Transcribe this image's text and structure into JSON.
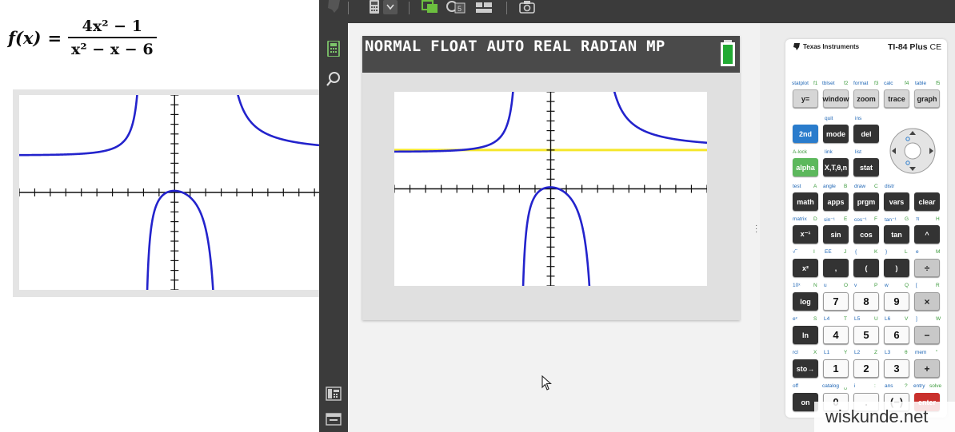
{
  "formula": {
    "lhs": "f(x)",
    "equals": "=",
    "numerator": "4x² − 1",
    "denominator": "x² − x − 6"
  },
  "calculator": {
    "status_text": "NORMAL FLOAT AUTO REAL RADIAN MP",
    "brand": "Texas Instruments",
    "model": "TI-84 Plus",
    "model_suffix": "CE"
  },
  "keys": {
    "y_equals": "y=",
    "window": "window",
    "zoom": "zoom",
    "trace": "trace",
    "graph": "graph",
    "second": "2nd",
    "mode": "mode",
    "del": "del",
    "alpha": "alpha",
    "xt_theta_n": "X,T,θ,n",
    "stat": "stat",
    "math": "math",
    "apps": "apps",
    "prgm": "prgm",
    "vars": "vars",
    "clear": "clear",
    "x_inverse": "x⁻¹",
    "sin": "sin",
    "cos": "cos",
    "tan": "tan",
    "caret": "^",
    "x_squared": "x²",
    "comma": ",",
    "lparen": "(",
    "rparen": ")",
    "divide": "÷",
    "log": "log",
    "seven": "7",
    "eight": "8",
    "nine": "9",
    "multiply": "×",
    "ln": "ln",
    "four": "4",
    "five": "5",
    "six": "6",
    "minus": "−",
    "sto": "sto→",
    "one": "1",
    "two": "2",
    "three": "3",
    "plus": "+",
    "on": "on",
    "zero": "0",
    "decimal": ".",
    "negative": "(−)",
    "enter": "enter"
  },
  "key_labels": {
    "statplot": "statplot",
    "f1": "f1",
    "tblset": "tblset",
    "f2": "f2",
    "format": "format",
    "f3": "f3",
    "calc": "calc",
    "f4": "f4",
    "table": "table",
    "f5": "f5",
    "quit": "quit",
    "ins": "ins",
    "a_lock": "A-lock",
    "link": "link",
    "list": "list",
    "test": "test",
    "a": "A",
    "angle": "angle",
    "b": "B",
    "draw": "draw",
    "c": "C",
    "distr": "distr",
    "matrix": "matrix",
    "d": "D",
    "sin_inv": "sin⁻¹",
    "e": "E",
    "cos_inv": "cos⁻¹",
    "f": "F",
    "tan_inv": "tan⁻¹",
    "g": "G",
    "pi": "π",
    "h": "H",
    "sqrt": "√‾",
    "i": "I",
    "ee": "EE",
    "j": "J",
    "lbrace": "{",
    "k": "K",
    "rbrace": "}",
    "l": "L",
    "e_const": "e",
    "m": "M",
    "ten_x": "10ˣ",
    "n": "N",
    "u": "u",
    "o": "O",
    "v": "v",
    "p": "P",
    "w": "w",
    "q": "Q",
    "lbracket": "[",
    "r": "R",
    "e_x": "eˣ",
    "s": "S",
    "l4": "L4",
    "t": "T",
    "l5": "L5",
    "u2": "U",
    "l6": "L6",
    "v2": "V",
    "rbracket": "]",
    "w2": "W",
    "rcl": "rcl",
    "x": "X",
    "l1": "L1",
    "y": "Y",
    "l2": "L2",
    "z": "Z",
    "l3": "L3",
    "theta": "θ",
    "mem": "mem",
    "quote": "\"",
    "off": "off",
    "catalog": "catalog",
    "space": "␣",
    "i_const": "i",
    "colon": ":",
    "ans": "ans",
    "question": "?",
    "entry": "entry",
    "solve": "solve"
  },
  "watermark": "wiskunde.net",
  "colors": {
    "graph_curve": "#2323cc",
    "trace_line": "#f5e62a",
    "status_bar": "#4a4a4a",
    "battery": "#22aa33",
    "toolbar_green": "#6cbf3f"
  },
  "icons": [
    "ti-logo-icon",
    "calculator-icon",
    "chevron-down-icon",
    "copy-screen-icon",
    "sync-icon",
    "layout-icon",
    "camera-icon",
    "keypad-icon",
    "search-icon",
    "keypad-toggle-icon",
    "window-icon",
    "battery-icon",
    "mouse-cursor-icon"
  ]
}
